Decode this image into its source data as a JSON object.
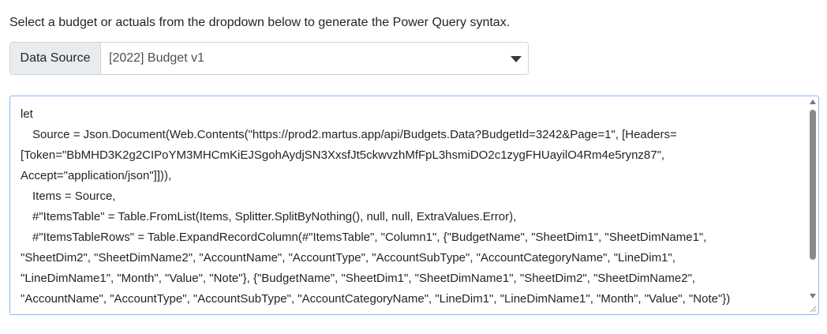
{
  "intro_text": "Select a budget or actuals from the dropdown below to generate the Power Query syntax.",
  "data_source": {
    "label": "Data Source",
    "selected_value": "[2022] Budget v1"
  },
  "query_lines": [
    "let",
    "Source = Json.Document(Web.Contents(\"https://prod2.martus.app/api/Budgets.Data?BudgetId=3242&Page=1\", [Headers=",
    "[Token=\"BbMHD3K2g2CIPoYM3MHCmKiEJSgohAydjSN3XxsfJt5ckwvzhMfFpL3hsmiDO2c1zygFHUayilO4Rm4e5rynz87\",",
    "Accept=\"application/json\"]])),",
    "Items = Source,",
    "#\"ItemsTable\" = Table.FromList(Items, Splitter.SplitByNothing(), null, null, ExtraValues.Error),",
    "#\"ItemsTableRows\" = Table.ExpandRecordColumn(#\"ItemsTable\", \"Column1\", {\"BudgetName\", \"SheetDim1\", \"SheetDimName1\",",
    "\"SheetDim2\", \"SheetDimName2\", \"AccountName\", \"AccountType\", \"AccountSubType\", \"AccountCategoryName\", \"LineDim1\",",
    "\"LineDimName1\", \"Month\", \"Value\", \"Note\"}, {\"BudgetName\", \"SheetDim1\", \"SheetDimName1\", \"SheetDim2\", \"SheetDimName2\",",
    "\"AccountName\", \"AccountType\", \"AccountSubType\", \"AccountCategoryName\", \"LineDim1\", \"LineDimName1\", \"Month\", \"Value\", \"Note\"})"
  ],
  "icons": {
    "dropdown": "caret-down-icon",
    "scroll_up": "scroll-up-icon",
    "scroll_down": "scroll-down-icon",
    "resize": "resize-grip-icon"
  },
  "colors": {
    "text": "#212529",
    "addon_bg": "#e9ecef",
    "border": "#ced4da",
    "focus_border": "#86b7fe"
  }
}
